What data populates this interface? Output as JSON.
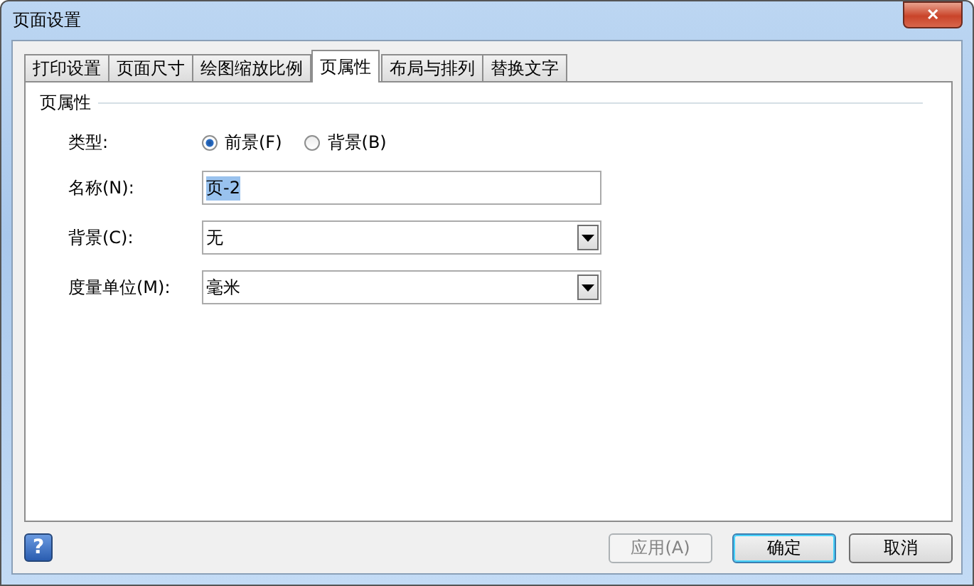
{
  "window": {
    "title": "页面设置",
    "close": "✕"
  },
  "tabs": [
    {
      "label": "打印设置",
      "selected": false
    },
    {
      "label": "页面尺寸",
      "selected": false
    },
    {
      "label": "绘图缩放比例",
      "selected": false
    },
    {
      "label": "页属性",
      "selected": true
    },
    {
      "label": "布局与排列",
      "selected": false
    },
    {
      "label": "替换文字",
      "selected": false
    }
  ],
  "group": {
    "title": "页属性"
  },
  "type_row": {
    "label": "类型:",
    "options": [
      {
        "label": "前景(F)",
        "selected": true
      },
      {
        "label": "背景(B)",
        "selected": false
      }
    ]
  },
  "fields": [
    {
      "kind": "text",
      "label": "名称(N):",
      "value": "页-2",
      "text_selected": true
    },
    {
      "kind": "dropdown",
      "label": "背景(C):",
      "value": "无"
    },
    {
      "kind": "dropdown",
      "label": "度量单位(M):",
      "value": "毫米"
    }
  ],
  "help": "?",
  "buttons": [
    {
      "label": "应用(A)",
      "disabled": true,
      "default": false
    },
    {
      "label": "确定",
      "disabled": false,
      "default": true
    },
    {
      "label": "取消",
      "disabled": false,
      "default": false
    }
  ]
}
